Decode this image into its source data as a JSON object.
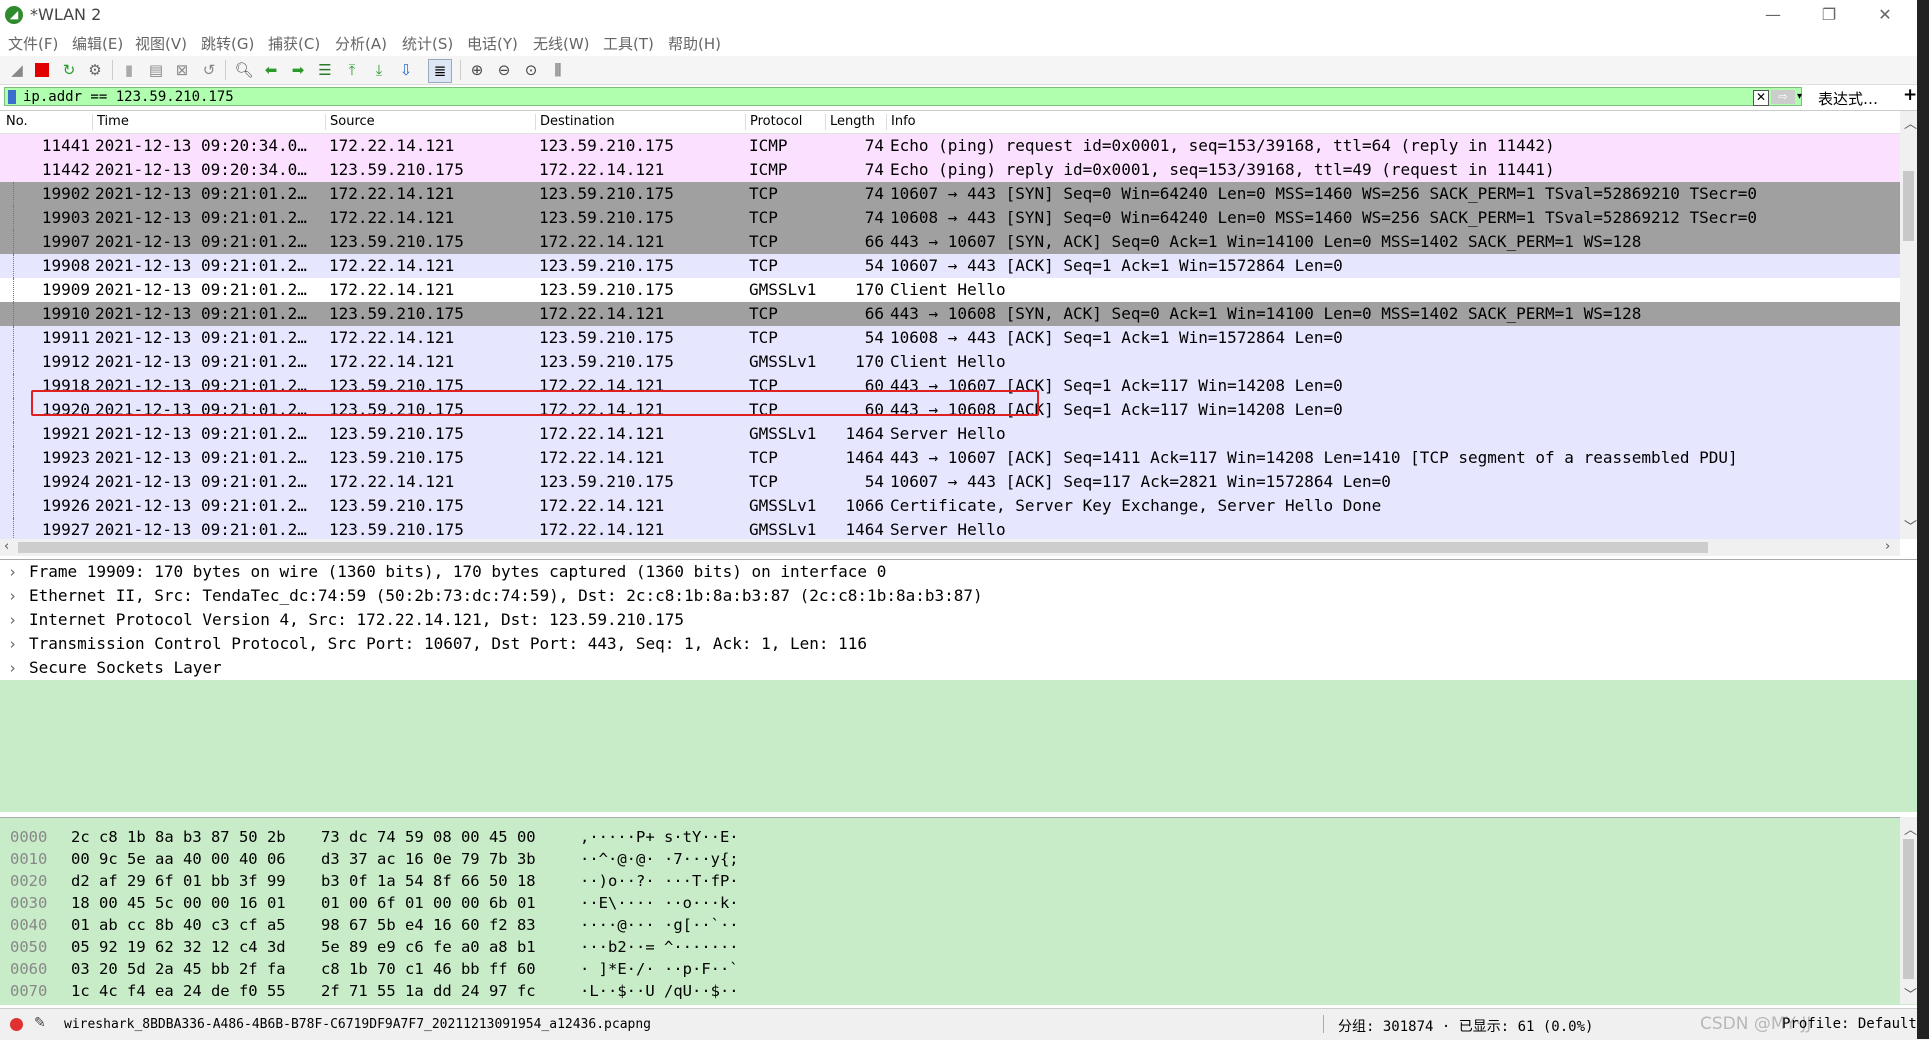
{
  "window": {
    "title": "*WLAN 2",
    "icon": "wireshark-fin-icon",
    "controls": [
      "minimize-icon",
      "restore-icon",
      "close-icon"
    ]
  },
  "menu": [
    "文件(F)",
    "编辑(E)",
    "视图(V)",
    "跳转(G)",
    "捕获(C)",
    "分析(A)",
    "统计(S)",
    "电话(Y)",
    "无线(W)",
    "工具(T)",
    "帮助(H)"
  ],
  "toolbar": {
    "icons": [
      "shark-fin-start-icon",
      "stop-icon",
      "restart-icon",
      "options-gear-icon",
      "open-file-icon",
      "file-icon",
      "close-file-icon",
      "reload-icon",
      "find-icon",
      "back-arrow-icon",
      "forward-arrow-icon",
      "goto-packet-icon",
      "first-packet-icon",
      "last-packet-icon",
      "autoscroll-icon",
      "colorize-icon",
      "zoom-in-icon",
      "zoom-out-icon",
      "zoom-reset-icon",
      "resize-columns-icon"
    ]
  },
  "filter": {
    "value": "ip.addr ==  123.59.210.175",
    "expression_label": "表达式…",
    "plus_label": "+"
  },
  "packet_list": {
    "columns": [
      "No.",
      "Time",
      "Source",
      "Destination",
      "Protocol",
      "Length",
      "Info"
    ],
    "rows": [
      {
        "no": "11441",
        "time": "2021-12-13 09:20:34.0…",
        "src": "172.22.14.121",
        "dst": "123.59.210.175",
        "proto": "ICMP",
        "len": "74",
        "info": "Echo (ping) request  id=0x0001, seq=153/39168, ttl=64 (reply in 11442)",
        "style": "icmp"
      },
      {
        "no": "11442",
        "time": "2021-12-13 09:20:34.0…",
        "src": "123.59.210.175",
        "dst": "172.22.14.121",
        "proto": "ICMP",
        "len": "74",
        "info": "Echo (ping) reply    id=0x0001, seq=153/39168, ttl=49 (request in 11441)",
        "style": "icmp"
      },
      {
        "no": "19902",
        "time": "2021-12-13 09:21:01.2…",
        "src": "172.22.14.121",
        "dst": "123.59.210.175",
        "proto": "TCP",
        "len": "74",
        "info": "10607 → 443 [SYN] Seq=0 Win=64240 Len=0 MSS=1460 WS=256 SACK_PERM=1 TSval=52869210 TSecr=0",
        "style": "syn"
      },
      {
        "no": "19903",
        "time": "2021-12-13 09:21:01.2…",
        "src": "172.22.14.121",
        "dst": "123.59.210.175",
        "proto": "TCP",
        "len": "74",
        "info": "10608 → 443 [SYN] Seq=0 Win=64240 Len=0 MSS=1460 WS=256 SACK_PERM=1 TSval=52869212 TSecr=0",
        "style": "syn"
      },
      {
        "no": "19907",
        "time": "2021-12-13 09:21:01.2…",
        "src": "123.59.210.175",
        "dst": "172.22.14.121",
        "proto": "TCP",
        "len": "66",
        "info": "443 → 10607 [SYN, ACK] Seq=0 Ack=1 Win=14100 Len=0 MSS=1402 SACK_PERM=1 WS=128",
        "style": "syn"
      },
      {
        "no": "19908",
        "time": "2021-12-13 09:21:01.2…",
        "src": "172.22.14.121",
        "dst": "123.59.210.175",
        "proto": "TCP",
        "len": "54",
        "info": "10607 → 443 [ACK] Seq=1 Ack=1 Win=1572864 Len=0",
        "style": "tcp"
      },
      {
        "no": "19909",
        "time": "2021-12-13 09:21:01.2…",
        "src": "172.22.14.121",
        "dst": "123.59.210.175",
        "proto": "GMSSLv1",
        "len": "170",
        "info": "Client Hello",
        "style": "selected"
      },
      {
        "no": "19910",
        "time": "2021-12-13 09:21:01.2…",
        "src": "123.59.210.175",
        "dst": "172.22.14.121",
        "proto": "TCP",
        "len": "66",
        "info": "443 → 10608 [SYN, ACK] Seq=0 Ack=1 Win=14100 Len=0 MSS=1402 SACK_PERM=1 WS=128",
        "style": "syn"
      },
      {
        "no": "19911",
        "time": "2021-12-13 09:21:01.2…",
        "src": "172.22.14.121",
        "dst": "123.59.210.175",
        "proto": "TCP",
        "len": "54",
        "info": "10608 → 443 [ACK] Seq=1 Ack=1 Win=1572864 Len=0",
        "style": "tcp"
      },
      {
        "no": "19912",
        "time": "2021-12-13 09:21:01.2…",
        "src": "172.22.14.121",
        "dst": "123.59.210.175",
        "proto": "GMSSLv1",
        "len": "170",
        "info": "Client Hello",
        "style": "ssl"
      },
      {
        "no": "19918",
        "time": "2021-12-13 09:21:01.2…",
        "src": "123.59.210.175",
        "dst": "172.22.14.121",
        "proto": "TCP",
        "len": "60",
        "info": "443 → 10607 [ACK] Seq=1 Ack=117 Win=14208 Len=0",
        "style": "tcp"
      },
      {
        "no": "19920",
        "time": "2021-12-13 09:21:01.2…",
        "src": "123.59.210.175",
        "dst": "172.22.14.121",
        "proto": "TCP",
        "len": "60",
        "info": "443 → 10608 [ACK] Seq=1 Ack=117 Win=14208 Len=0",
        "style": "tcp"
      },
      {
        "no": "19921",
        "time": "2021-12-13 09:21:01.2…",
        "src": "123.59.210.175",
        "dst": "172.22.14.121",
        "proto": "GMSSLv1",
        "len": "1464",
        "info": "Server Hello",
        "style": "ssl"
      },
      {
        "no": "19923",
        "time": "2021-12-13 09:21:01.2…",
        "src": "123.59.210.175",
        "dst": "172.22.14.121",
        "proto": "TCP",
        "len": "1464",
        "info": "443 → 10607 [ACK] Seq=1411 Ack=117 Win=14208 Len=1410 [TCP segment of a reassembled PDU]",
        "style": "tcp"
      },
      {
        "no": "19924",
        "time": "2021-12-13 09:21:01.2…",
        "src": "172.22.14.121",
        "dst": "123.59.210.175",
        "proto": "TCP",
        "len": "54",
        "info": "10607 → 443 [ACK] Seq=117 Ack=2821 Win=1572864 Len=0",
        "style": "tcp"
      },
      {
        "no": "19926",
        "time": "2021-12-13 09:21:01.2…",
        "src": "123.59.210.175",
        "dst": "172.22.14.121",
        "proto": "GMSSLv1",
        "len": "1066",
        "info": "Certificate, Server Key Exchange, Server Hello Done",
        "style": "ssl"
      },
      {
        "no": "19927",
        "time": "2021-12-13 09:21:01.2…",
        "src": "123.59.210.175",
        "dst": "172.22.14.121",
        "proto": "GMSSLv1",
        "len": "1464",
        "info": "Server Hello",
        "style": "ssl"
      }
    ]
  },
  "details": [
    "Frame 19909: 170 bytes on wire (1360 bits), 170 bytes captured (1360 bits) on interface 0",
    "Ethernet II, Src: TendaTec_dc:74:59 (50:2b:73:dc:74:59), Dst: 2c:c8:1b:8a:b3:87 (2c:c8:1b:8a:b3:87)",
    "Internet Protocol Version 4, Src: 172.22.14.121, Dst: 123.59.210.175",
    "Transmission Control Protocol, Src Port: 10607, Dst Port: 443, Seq: 1, Ack: 1, Len: 116",
    "Secure Sockets Layer"
  ],
  "bytes": [
    {
      "off": "0000",
      "h1": "2c c8 1b 8a b3 87 50 2b",
      "h2": "73 dc 74 59 08 00 45 00",
      "ascii": ",·····P+ s·tY··E·"
    },
    {
      "off": "0010",
      "h1": "00 9c 5e aa 40 00 40 06",
      "h2": "d3 37 ac 16 0e 79 7b 3b",
      "ascii": "··^·@·@· ·7···y{;"
    },
    {
      "off": "0020",
      "h1": "d2 af 29 6f 01 bb 3f 99",
      "h2": "b3 0f 1a 54 8f 66 50 18",
      "ascii": "··)o··?· ···T·fP·"
    },
    {
      "off": "0030",
      "h1": "18 00 45 5c 00 00 16 01",
      "h2": "01 00 6f 01 00 00 6b 01",
      "ascii": "··E\\···· ··o···k·"
    },
    {
      "off": "0040",
      "h1": "01 ab cc 8b 40 c3 cf a5",
      "h2": "98 67 5b e4 16 60 f2 83",
      "ascii": "····@··· ·g[··`··"
    },
    {
      "off": "0050",
      "h1": "05 92 19 62 32 12 c4 3d",
      "h2": "5e 89 e9 c6 fe a0 a8 b1",
      "ascii": "···b2··= ^·······"
    },
    {
      "off": "0060",
      "h1": "03 20 5d 2a 45 bb 2f fa",
      "h2": "c8 1b 70 c1 46 bb ff 60",
      "ascii": "· ]*E·/· ··p·F··`"
    },
    {
      "off": "0070",
      "h1": "1c 4c f4 ea 24 de f0 55",
      "h2": "2f 71 55 1a dd 24 97 fc",
      "ascii": "·L··$··U /qU··$··"
    }
  ],
  "status": {
    "file": "wireshark_8BDBA336-A486-4B6B-B78F-C6719DF9A7F7_20211213091954_a12436.pcapng",
    "counts": "分组: 301874 · 已显示: 61 (0.0%)",
    "profile": "Profile: Default",
    "watermark": "CSDN @MY·JJ"
  },
  "colors": {
    "filter_valid": "#afffaf",
    "icmp_row": "#fce0ff",
    "tcp_row": "#e7e6ff",
    "syn_row": "#a0a0a0",
    "pane_bg": "#c8ecc8",
    "highlight": "#e02020"
  }
}
